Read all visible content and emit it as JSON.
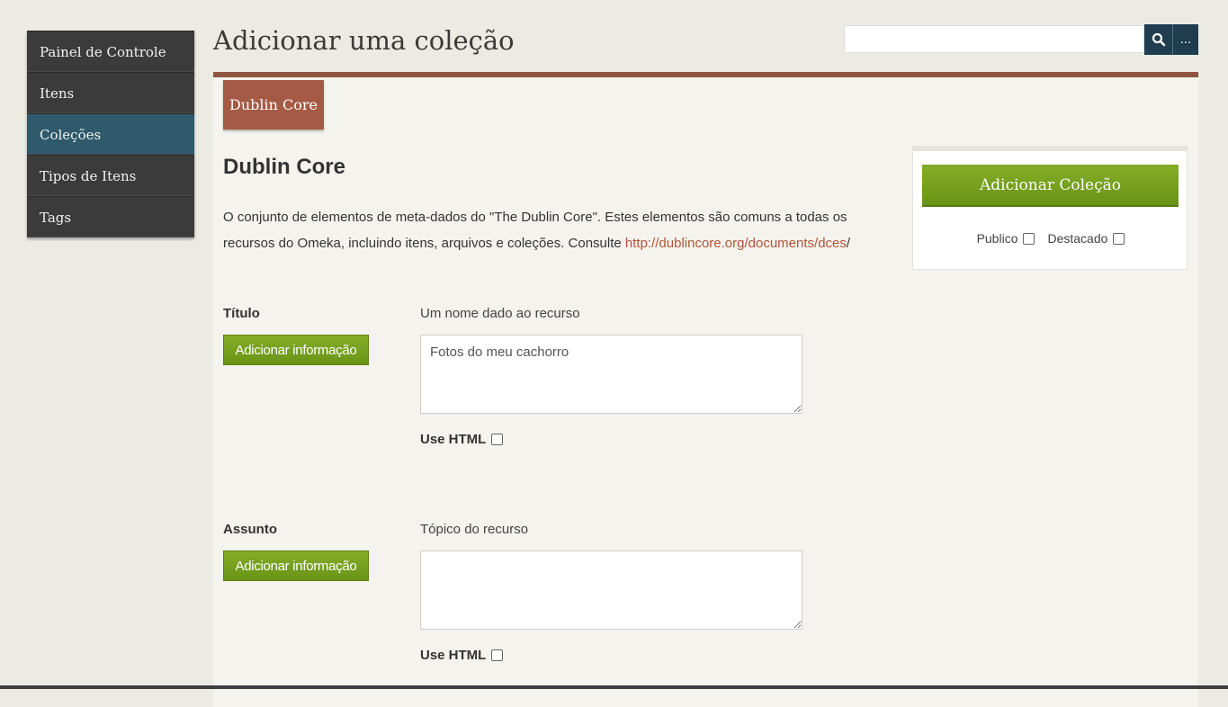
{
  "nav": {
    "items": [
      {
        "label": "Painel de Controle"
      },
      {
        "label": "Itens"
      },
      {
        "label": "Coleções"
      },
      {
        "label": "Tipos de Itens"
      },
      {
        "label": "Tags"
      }
    ],
    "active_index": 2
  },
  "header": {
    "title": "Adicionar uma coleção",
    "search_value": "",
    "advanced_label": "..."
  },
  "tab": {
    "label": "Dublin Core"
  },
  "section": {
    "title": "Dublin Core",
    "desc_text": "O conjunto de elementos de meta-dados do \"The Dublin Core\". Estes elementos são comuns a todas os recursos do Omeka, incluindo itens, arquivos e coleções. Consulte ",
    "desc_link": "http://dublincore.org/documents/dces",
    "desc_after": "/"
  },
  "fields": [
    {
      "label": "Título",
      "add_label": "Adicionar informação",
      "hint": "Um nome dado ao recurso",
      "value": "Fotos do meu cachorro",
      "use_html_label": "Use HTML"
    },
    {
      "label": "Assunto",
      "add_label": "Adicionar informação",
      "hint": "Tópico do recurso",
      "value": "",
      "use_html_label": "Use HTML"
    }
  ],
  "save": {
    "button_label": "Adicionar Coleção",
    "public_label": "Publico",
    "featured_label": "Destacado"
  },
  "colors": {
    "nav_bg": "#3b3b3b",
    "nav_active": "#2e5a6b",
    "accent_brown": "#8f5540",
    "tab_bg": "#a55a45",
    "green_button": "#6a9416",
    "link": "#b1543a",
    "search_button": "#1f3d4e"
  },
  "icons": {
    "search": "search-icon"
  }
}
